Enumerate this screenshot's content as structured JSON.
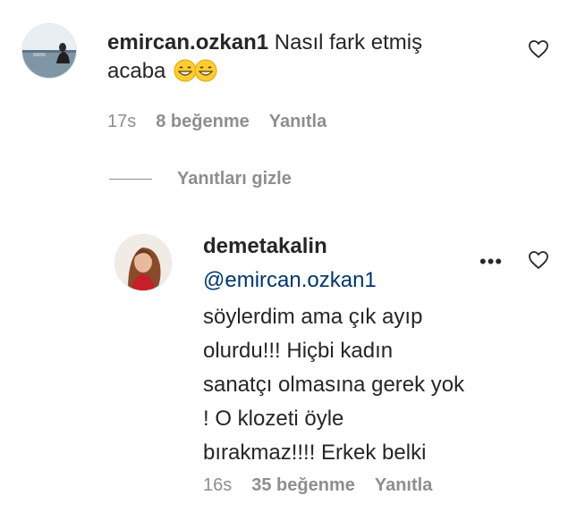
{
  "comment1": {
    "username": "emircan.ozkan1",
    "text_line1": "Nasıl fark etmiş",
    "text_line2": "acaba",
    "emoji": "grinning-face-emoji",
    "time": "17s",
    "likes": "8 beğenme",
    "reply_label": "Yanıtla"
  },
  "replies_toggle": "Yanıtları gizle",
  "comment2": {
    "username": "demetakalin",
    "mention": "@emircan.ozkan1",
    "lines": [
      "söylerdim ama çık ayıp",
      "olurdu!!! Hiçbi kadın",
      "sanatçı olmasına gerek yok",
      "! O klozeti öyle",
      "bırakmaz!!!! Erkek belki"
    ],
    "time": "16s",
    "likes": "35 beğenme",
    "reply_label": "Yanıtla",
    "more_label": "•••"
  },
  "icons": {
    "like": "heart-outline-icon",
    "more": "more-options-icon"
  },
  "colors": {
    "text": "#262626",
    "muted": "#8e8e8e",
    "mention": "#00376b"
  }
}
